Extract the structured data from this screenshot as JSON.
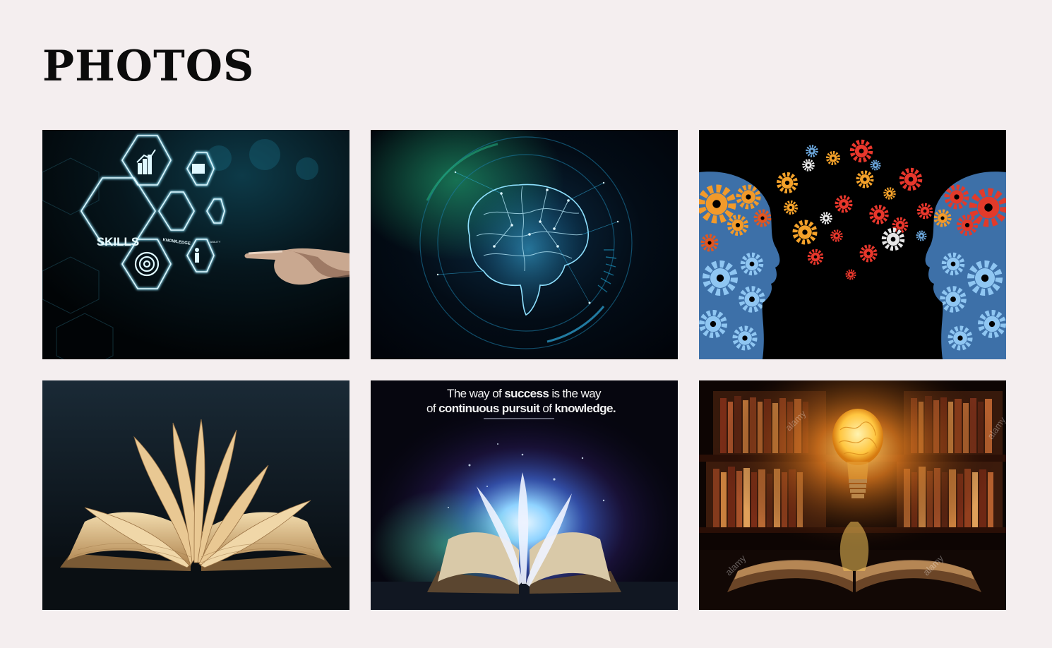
{
  "header": {
    "title": "PHOTOS"
  },
  "photos": [
    {
      "id": "skills",
      "icon": "skills-hexagon-interface-photo",
      "labels": {
        "skills": "SKILLS",
        "knowledge": "KNOWLEDGE",
        "ability": "ABILITY"
      }
    },
    {
      "id": "brain",
      "icon": "digital-brain-photo"
    },
    {
      "id": "gears",
      "icon": "gear-heads-photo"
    },
    {
      "id": "book",
      "icon": "open-book-photo"
    },
    {
      "id": "quote",
      "icon": "glowing-book-quote-photo",
      "quote": {
        "line1": [
          "The way of ",
          "success",
          " is the way"
        ],
        "line2": [
          "of ",
          "continuous pursuit",
          " of ",
          "knowledge."
        ]
      }
    },
    {
      "id": "bulb",
      "icon": "lightbulb-library-photo",
      "watermark": "alamy"
    }
  ]
}
